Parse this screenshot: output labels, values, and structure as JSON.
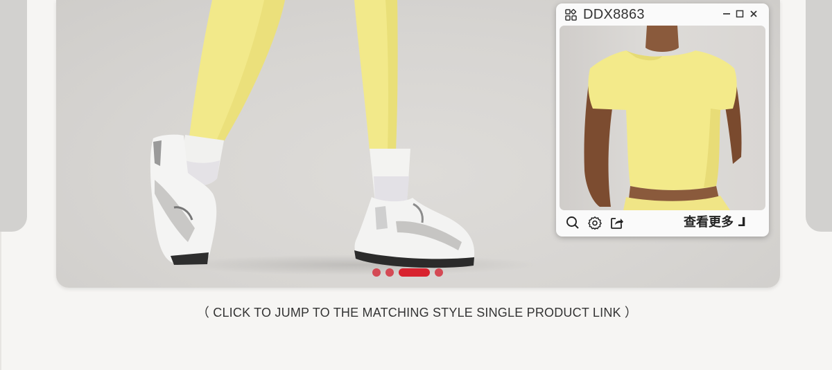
{
  "popup": {
    "title": "DDX8863",
    "more_label": "查看更多 ⅃"
  },
  "carousel": {
    "total_slides": 4,
    "active_index": 2
  },
  "caption": "（ CLICK TO JUMP TO THE MATCHING STYLE SINGLE PRODUCT LINK ）",
  "icons": [
    "apps-icon",
    "minimize-icon",
    "maximize-icon",
    "close-icon",
    "zoom-icon",
    "settings-icon",
    "share-icon"
  ],
  "colors": {
    "accent": "#d8232f",
    "page_background": "#f6f5f3",
    "product_yellow": "#f3ea8a"
  }
}
